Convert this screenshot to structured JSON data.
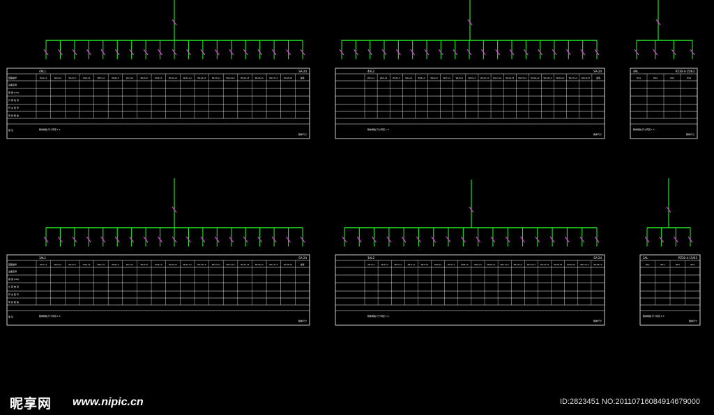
{
  "watermark": {
    "logo": "昵享网",
    "url": "www.nipic.cn",
    "id_text": "ID:2823451 NO:20110716084914679000"
  },
  "colors": {
    "bus": "#22e622",
    "breaker": "#e23ce2",
    "table_line": "#ffffff",
    "text": "#ffffff",
    "background": "#000000"
  },
  "panels": [
    {
      "id": "p1",
      "feeders": 19,
      "code_left": "4AL1",
      "code_right": "SA-24",
      "circuit_labels": [
        "WL1-L1",
        "WL2-L2",
        "WL3-L3",
        "WL4-L1",
        "WL5-L2",
        "WL6-L3",
        "WL7-L1",
        "WL8-L2",
        "WL9-L3",
        "WL10-L1",
        "WL11-L2",
        "WL12-L3",
        "WL13-L1",
        "WL14-L2",
        "WL15-L3",
        "WL16-L1",
        "WL17-L2",
        "WL18-L3",
        "备用"
      ],
      "row_labels": [
        "回路编号",
        "设备名称",
        "容 量 (kW)",
        "计 算 电 流",
        "开 关 型 号",
        "导 线 规 格",
        "备   注"
      ],
      "footnote": "箱体规格,尺寸待定.1.5",
      "tag": "箱体尺寸"
    },
    {
      "id": "p2",
      "feeders": 19,
      "code_left": "4AL2",
      "code_right": "SA-24",
      "circuit_labels": [
        "WL1-L1",
        "WL2-L2",
        "WL3-L3",
        "WL4-L1",
        "WL5-L2",
        "WL6-L3",
        "WL7-L1",
        "WL8-L2",
        "WL9-L3",
        "WL10-L1",
        "WL11-L2",
        "WL12-L3",
        "WL13-L1",
        "WL14-L2",
        "WL15-L3",
        "WL16-L1",
        "WL17-L2",
        "WL18-L3",
        "备用"
      ],
      "row_labels": [
        "",
        "",
        "",
        "",
        "",
        "",
        ""
      ],
      "footnote": "箱体规格,尺寸待定.1.5",
      "tag": "箱体尺寸"
    },
    {
      "id": "p3",
      "feeders": 4,
      "code_left": "4AL",
      "code_right": "PZ30-4-15/63",
      "circuit_labels": [
        "WL1",
        "WL2",
        "WL3",
        "WL4"
      ],
      "row_labels": [
        "",
        "",
        "",
        "",
        "",
        "",
        ""
      ],
      "footnote": "箱体规格,尺寸待定.1.5",
      "tag": "箱体尺寸"
    },
    {
      "id": "p4",
      "feeders": 19,
      "code_left": "3AL1",
      "code_right": "SA-24",
      "circuit_labels": [
        "WL1-L1",
        "WL2-L2",
        "WL3-L3",
        "WL4-L1",
        "WL5-L2",
        "WL6-L3",
        "WL7-L1",
        "WL8-L2",
        "WL9-L3",
        "WL10-L1",
        "WL11-L2",
        "WL12-L3",
        "WL13-L1",
        "WL14-L2",
        "WL15-L3",
        "WL16-L1",
        "WL17-L2",
        "WL18-L3",
        "备用"
      ],
      "row_labels": [
        "回路编号",
        "设备名称",
        "容 量 (kW)",
        "计 算 电 流",
        "开 关 型 号",
        "导 线 规 格",
        "备   注"
      ],
      "footnote": "箱体规格,尺寸待定.1.5",
      "tag": "箱体尺寸"
    },
    {
      "id": "p5",
      "feeders": 18,
      "code_left": "3AL2",
      "code_right": "SA-24",
      "circuit_labels": [
        "WL1-L1",
        "WL2-L2",
        "WL3-L3",
        "WL4-L1",
        "WL5-L2",
        "WL6-L3",
        "WL7-L1",
        "WL8-L2",
        "WL9-L3",
        "WL10-L1",
        "WL11-L2",
        "WL12-L3",
        "WL13-L1",
        "WL14-L2",
        "WL15-L3",
        "WL16-L1",
        "WL17-L2",
        "WL18-L3"
      ],
      "row_labels": [
        "",
        "",
        "",
        "",
        "",
        "",
        ""
      ],
      "footnote": "箱体规格,尺寸待定.1.5",
      "tag": "箱体尺寸"
    },
    {
      "id": "p6",
      "feeders": 4,
      "code_left": "3AL",
      "code_right": "PZ30-4-15/63",
      "circuit_labels": [
        "WL1",
        "WL2",
        "WL3",
        "WL4"
      ],
      "row_labels": [
        "",
        "",
        "",
        "",
        "",
        "",
        ""
      ],
      "footnote": "箱体规格,尺寸待定.1.5",
      "tag": "箱体尺寸"
    }
  ]
}
